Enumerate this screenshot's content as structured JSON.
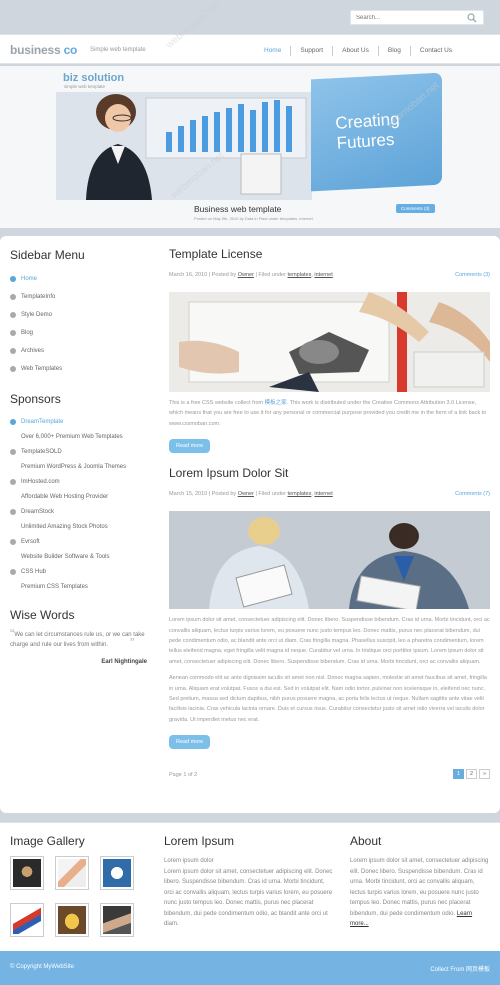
{
  "search": {
    "placeholder": "Search..."
  },
  "brand": {
    "logo_main": "business",
    "logo_accent": "co",
    "tagline": "Simple web template"
  },
  "nav": [
    "Home",
    "Support",
    "About Us",
    "Blog",
    "Contact Us"
  ],
  "banner": {
    "title": "biz solution",
    "subtitle": "simple web template",
    "headline_line1": "Creating",
    "headline_line2": "Futures",
    "caption_title": "Business web template",
    "caption_meta": "Posted on May 5th, 2010 by Data in Filed under templates, internet",
    "caption_comments": "Comments (3)"
  },
  "sidebar": {
    "menu_heading": "Sidebar Menu",
    "menu_items": [
      "Home",
      "TemplateInfo",
      "Style Demo",
      "Blog",
      "Archives",
      "Web Templates"
    ],
    "sponsors_heading": "Sponsors",
    "sponsors": [
      {
        "name": "DreamTemplate",
        "desc": "Over 6,000+ Premium Web Templates"
      },
      {
        "name": "TemplateSOLD",
        "desc": "Premium WordPress & Joomla Themes"
      },
      {
        "name": "ImHosted.com",
        "desc": "Affordable Web Hosting Provider"
      },
      {
        "name": "DreamStock",
        "desc": "Unlimited Amazing Stock Photos"
      },
      {
        "name": "Evrsoft",
        "desc": "Website Builder Software & Tools"
      },
      {
        "name": "CSS Hub",
        "desc": "Premium CSS Templates"
      }
    ],
    "wise_heading": "Wise Words",
    "quote": "We can let circumstances rule us, or we can take charge and rule our lives from within.",
    "quote_author": "Earl Nightingale"
  },
  "posts": [
    {
      "title": "Template License",
      "date": "March 16, 2010",
      "posted_by_prefix": "Posted by",
      "author": "Owner",
      "filed_prefix": "Filed under",
      "tag1": "templates",
      "tag2": "internet",
      "comments": "Comments (3)",
      "body_before_link": "This is a free CSS website collect from ",
      "body_link": "模板之家",
      "body_after_link": ". This work is distributed under the Creative Commons Attribution 3.0 License, which means that you are free to use it for any personal or commercial purpose provided you credit me in the form of a link back to www.cssmoban.com.",
      "read_more": "Read more"
    },
    {
      "title": "Lorem Ipsum Dolor Sit",
      "date": "March 15, 2010",
      "posted_by_prefix": "Posted by",
      "author": "Owner",
      "filed_prefix": "Filed under",
      "tag1": "templates",
      "tag2": "internet",
      "comments": "Comments (7)",
      "para1": "Lorem ipsum dolor sit amet, consectetuer adipiscing elit. Donec libero. Suspendisse bibendum. Cras id urna. Morbi tincidunt, orci ac convallis aliquam, lectus turpis varius lorem, eu posuere nunc justo tempus leo. Donec mattis, purus nec placerat bibendum, dui pede condimentum odio, ac blandit ante orci ut diam. Cras fringilla magna. Phasellus suscipit, leo a pharetra condimentum, lorem tellus eleifend magna, eget fringilla velit magna id neque. Curabitur vel urna. In tristique orci porttitor ipsum. Lorem ipsum dolor sit amet, consectetuer adipiscing elit. Donec libero. Suspendisse bibendum. Cras id urna. Morbi tincidunt, orci ac convallis aliquam.",
      "para2": "Aenean commodo elit ac ante dignissim iaculis sit amet non nisl. Donec magna sapien, molestie sit amet faucibus sit amet, fringilla in urna. Aliquam erat volutpat. Fusce a dui est. Sed in volutpat elit. Nam odio tortor, pulvinar non scelerisque in, eleifend nec nunc. Sed pretium, massa sed dictum dapibus, nibh purus posuere magna, ac porta felis lectus ut neque. Nullam sagittis ante vitae velit facilisis lacinia. Cras vehicula lacinia ornare. Duis et cursus risus. Curabitur consectetur justo sit amet odio viverra vel iaculis dolor gravida. Ut imperdiet metus nec erat.",
      "read_more": "Read more"
    }
  ],
  "pagination": {
    "label": "Page 1 of 2",
    "pages": [
      "1",
      "2",
      "»"
    ]
  },
  "footer": {
    "gallery_heading": "Image Gallery",
    "lorem_heading": "Lorem Ipsum",
    "lorem_line1": "Lorem ipsum dolor",
    "lorem_text": "Lorem ipsum dolor sit amet, consectetuer adipiscing elit. Donec libero. Suspendisse bibendum. Cras id urna. Morbi tincidunt, orci ac convallis aliquam, lectus turpis varius lorem, eu posuere nunc justo tempus leo. Donec mattis, purus nec placerat bibendum, dui pede condimentum odio, ac blandit ante orci ut diam.",
    "about_heading": "About",
    "about_text": "Lorem ipsum dolor sit amet, consectetuer adipiscing elit. Donec libero. Suspendisse bibendum. Cras id urna. Morbi tincidunt, orci ac convallis aliquam, lectus turpis varius lorem, eu posuere nunc justo tempus leo. Donec mattis, purus nec placerat bibendum, dui pede condimentum odio.",
    "about_link": "Learn more..."
  },
  "bottom": {
    "copyright": "© Copyright MyWebSite",
    "download": "Collect From 网页模板"
  },
  "colors": {
    "accent": "#5aa5da",
    "panel": "#74b3e2",
    "background": "#cfd6de"
  }
}
